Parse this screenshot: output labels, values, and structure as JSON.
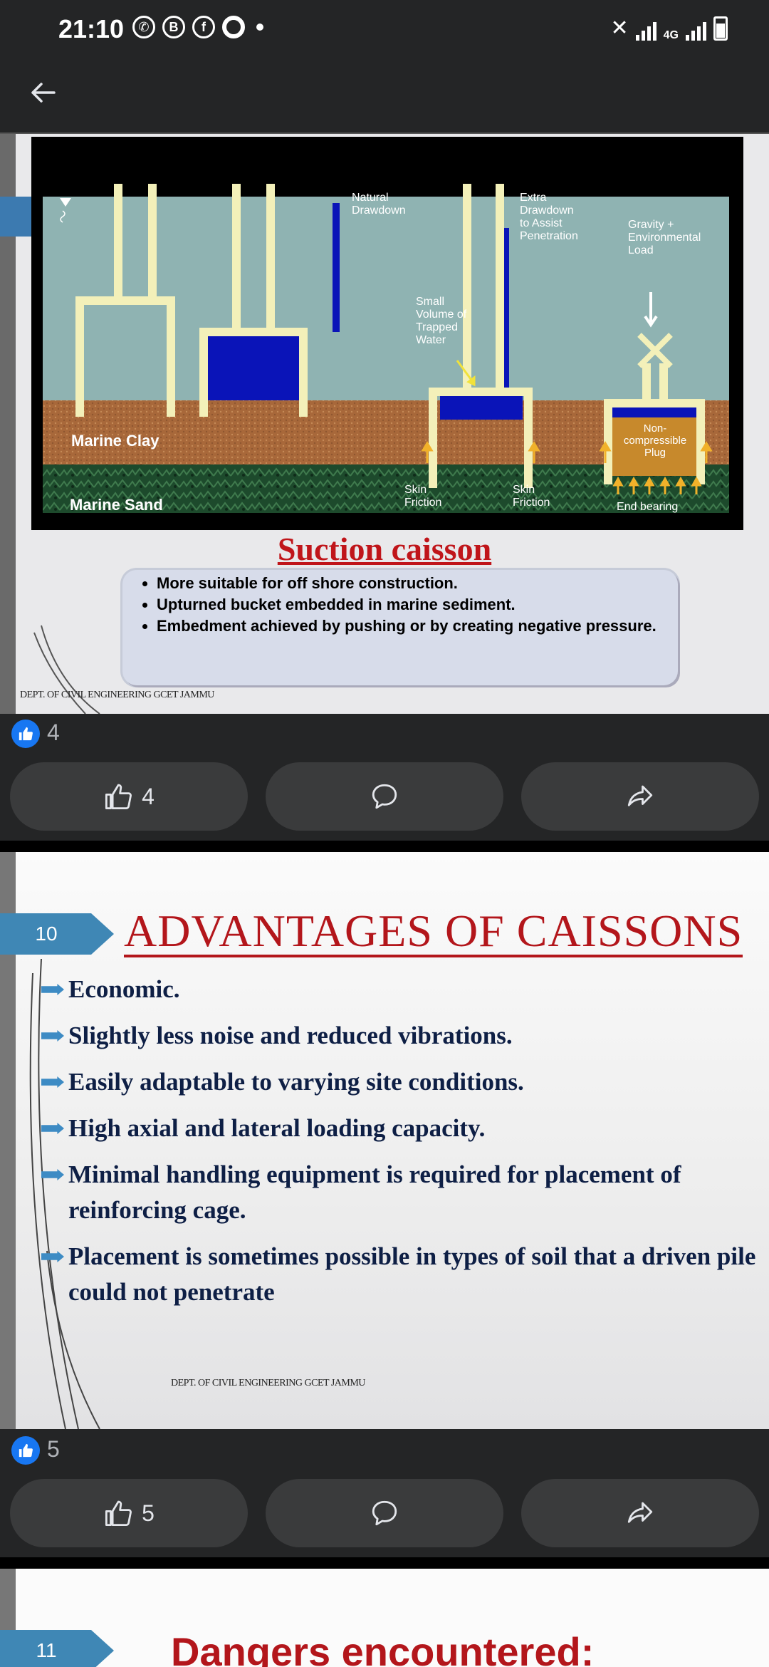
{
  "status_bar": {
    "time": "21:10",
    "app_icons": [
      "whatsapp-icon",
      "b-circle-icon",
      "facebook-icon",
      "opera-icon"
    ],
    "network": "4G"
  },
  "nav": {
    "back_label": "Back"
  },
  "post1": {
    "diagram": {
      "layer_clay": "Marine Clay",
      "layer_sand": "Marine Sand",
      "label_natural": [
        "Natural",
        "Drawdown"
      ],
      "label_extra": [
        "Extra",
        "Drawdown",
        "to Assist",
        "Penetration"
      ],
      "label_small": [
        "Small",
        "Volume of",
        "Trapped",
        "Water"
      ],
      "label_gravity": [
        "Gravity +",
        "Environmental",
        "Load"
      ],
      "label_plug": [
        "Non-",
        "compressible",
        "Plug"
      ],
      "label_skin1": [
        "Skin",
        "Friction"
      ],
      "label_skin2": [
        "Skin",
        "Friction"
      ],
      "label_end": "End bearing"
    },
    "title": "Suction caisson",
    "bullets": [
      "More suitable for off shore construction.",
      "Upturned bucket embedded in marine sediment.",
      "Embedment achieved by pushing or by creating negative pressure."
    ],
    "dept": "DEPT. OF CIVIL ENGINEERING GCET JAMMU",
    "like_count": "4",
    "like_button_count": "4"
  },
  "post2": {
    "slide_number": "10",
    "title": "ADVANTAGES OF CAISSONS",
    "items": [
      "Economic.",
      "Slightly less noise and reduced vibrations.",
      "Easily adaptable to varying site conditions.",
      "High axial and lateral loading capacity.",
      "Minimal handling equipment is required for placement of reinforcing cage.",
      "Placement is sometimes possible in types of soil that a driven pile could not penetrate"
    ],
    "dept": "DEPT. OF CIVIL ENGINEERING GCET JAMMU",
    "like_count": "5",
    "like_button_count": "5"
  },
  "post3": {
    "slide_number": "11",
    "title": "Dangers encountered:"
  },
  "colors": {
    "like_blue": "#1877f2",
    "title_red": "#b3161b",
    "tab_blue": "#3f87b5"
  }
}
